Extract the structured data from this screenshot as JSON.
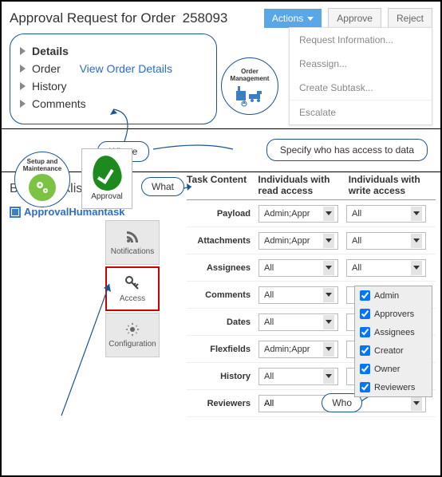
{
  "header": {
    "title_prefix": "Approval Request for Order",
    "order_number": "258093",
    "actions_label": "Actions",
    "approve_label": "Approve",
    "reject_label": "Reject"
  },
  "details": {
    "details_label": "Details",
    "order_label": "Order",
    "view_order_link": "View Order Details",
    "history_label": "History",
    "comments_label": "Comments"
  },
  "actions_menu": {
    "items": [
      "Request Information...",
      "Reassign...",
      "Create Subtask...",
      "Escalate"
    ]
  },
  "om_badge": {
    "line1": "Order",
    "line2": "Management"
  },
  "annotations": {
    "where": "Where",
    "what": "What",
    "who": "Who",
    "spec": "Specify who has access to data"
  },
  "bpm": {
    "title": "BPM Worklist",
    "task_name": "ApprovalHumantask"
  },
  "side_tabs": {
    "notifications": "Notifications",
    "access": "Access",
    "configuration": "Configuration"
  },
  "table": {
    "col_task": "Task Content",
    "col_read": "Individuals with read access",
    "col_write": "Individuals with write access",
    "rows": [
      {
        "label": "Payload",
        "read": "Admin;Appr",
        "write": "All"
      },
      {
        "label": "Attachments",
        "read": "Admin;Appr",
        "write": "All"
      },
      {
        "label": "Assignees",
        "read": "All",
        "write": "All"
      },
      {
        "label": "Comments",
        "read": "All",
        "write": ""
      },
      {
        "label": "Dates",
        "read": "All",
        "write": ""
      },
      {
        "label": "Flexfields",
        "read": "Admin;Appr",
        "write": ""
      },
      {
        "label": "History",
        "read": "All",
        "write": ""
      },
      {
        "label": "Reviewers",
        "read": "All",
        "write": ""
      }
    ]
  },
  "dropdown_options": [
    "Admin",
    "Approvers",
    "Assignees",
    "Creator",
    "Owner",
    "Reviewers"
  ],
  "setup_badge": {
    "line1": "Setup and",
    "line2": "Maintenance"
  },
  "approval_badge": {
    "label": "Approval"
  }
}
